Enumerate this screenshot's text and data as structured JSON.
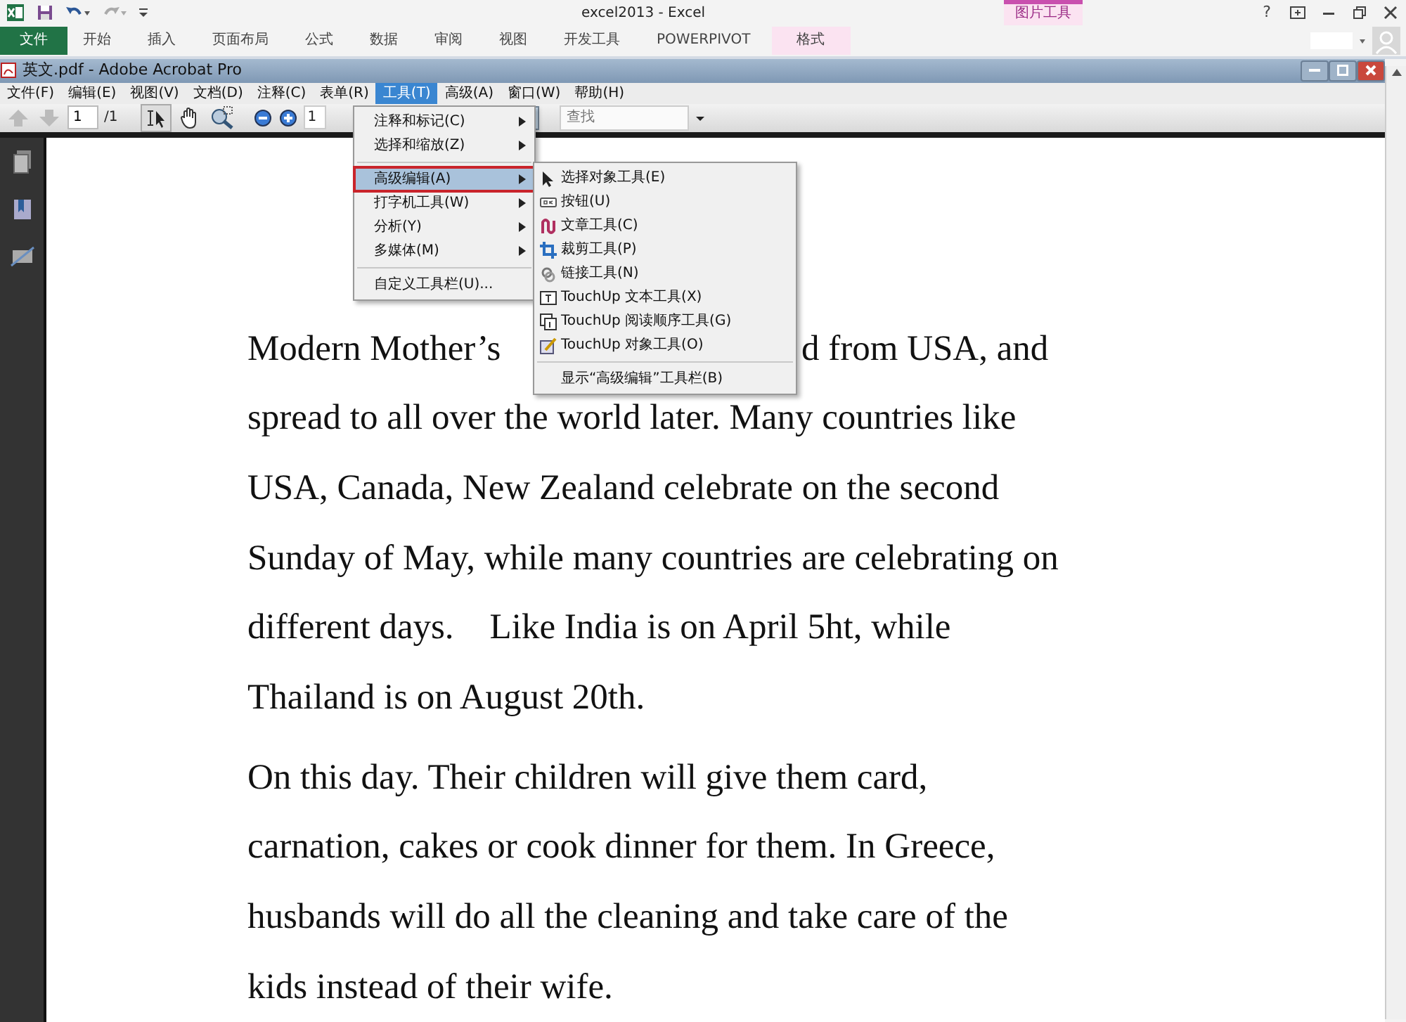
{
  "excel": {
    "title": "excel2013 - Excel",
    "context_group": "图片工具",
    "tabs": [
      {
        "label": "文件",
        "kind": "file"
      },
      {
        "label": "开始",
        "kind": "normal"
      },
      {
        "label": "插入",
        "kind": "normal"
      },
      {
        "label": "页面布局",
        "kind": "normal"
      },
      {
        "label": "公式",
        "kind": "normal"
      },
      {
        "label": "数据",
        "kind": "normal"
      },
      {
        "label": "审阅",
        "kind": "normal"
      },
      {
        "label": "视图",
        "kind": "normal"
      },
      {
        "label": "开发工具",
        "kind": "normal"
      },
      {
        "label": "POWERPIVOT",
        "kind": "normal"
      },
      {
        "label": "格式",
        "kind": "contextual"
      }
    ],
    "help": "?"
  },
  "acrobat": {
    "title": "英文.pdf - Adobe Acrobat Pro",
    "menu": [
      {
        "label": "文件(F)",
        "selected": false
      },
      {
        "label": "编辑(E)",
        "selected": false
      },
      {
        "label": "视图(V)",
        "selected": false
      },
      {
        "label": "文档(D)",
        "selected": false
      },
      {
        "label": "注释(C)",
        "selected": false
      },
      {
        "label": "表单(R)",
        "selected": false
      },
      {
        "label": "工具(T)",
        "selected": true
      },
      {
        "label": "高级(A)",
        "selected": false
      },
      {
        "label": "窗口(W)",
        "selected": false
      },
      {
        "label": "帮助(H)",
        "selected": false
      }
    ],
    "toolbar": {
      "page_number": "1",
      "page_count": "/1",
      "zoom": "1",
      "search": {
        "placeholder": "查找"
      }
    },
    "tools_menu": [
      {
        "kind": "item",
        "label": "注释和标记(C)",
        "selected": false,
        "marked": false
      },
      {
        "kind": "item",
        "label": "选择和缩放(Z)",
        "selected": false,
        "marked": false
      },
      {
        "kind": "separator"
      },
      {
        "kind": "item",
        "label": "高级编辑(A)",
        "selected": true,
        "marked": true
      },
      {
        "kind": "item",
        "label": "打字机工具(W)",
        "selected": false,
        "marked": false
      },
      {
        "kind": "item",
        "label": "分析(Y)",
        "selected": false,
        "marked": false
      },
      {
        "kind": "item",
        "label": "多媒体(M)",
        "selected": false,
        "marked": false
      },
      {
        "kind": "separator"
      },
      {
        "kind": "command",
        "label": "自定义工具栏(U)..."
      }
    ],
    "submenu": [
      {
        "kind": "tool",
        "label": "选择对象工具(E)"
      },
      {
        "kind": "tool",
        "label": "按钮(U)"
      },
      {
        "kind": "tool",
        "label": "文章工具(C)"
      },
      {
        "kind": "tool",
        "label": "裁剪工具(P)"
      },
      {
        "kind": "tool",
        "label": "链接工具(N)"
      },
      {
        "kind": "tool",
        "label": "TouchUp 文本工具(X)"
      },
      {
        "kind": "tool",
        "label": "TouchUp 阅读顺序工具(G)"
      },
      {
        "kind": "tool",
        "label": "TouchUp 对象工具(O)"
      },
      {
        "kind": "separator"
      },
      {
        "kind": "command",
        "label": "显示“高级编辑”工具栏(B)"
      }
    ]
  },
  "document": {
    "paragraphs": [
      {
        "lines": [
          [
            "Modern Mother’s",
            "d from USA, and"
          ],
          [
            "spread to all over the world later. Many countries like"
          ],
          [
            "USA, Canada, New Zealand celebrate on the second"
          ],
          [
            "Sunday of May, while many countries are celebrating on"
          ],
          [
            "different days.    Like India is on April 5ht, while"
          ],
          [
            "Thailand is on August 20th."
          ]
        ]
      },
      {
        "lines": [
          [
            "On this day. Their children will give them card,"
          ],
          [
            "carnation, cakes or cook dinner for them. In Greece,"
          ],
          [
            "husbands will do all the cleaning and take care of the"
          ],
          [
            "kids instead of their wife."
          ]
        ]
      }
    ]
  }
}
